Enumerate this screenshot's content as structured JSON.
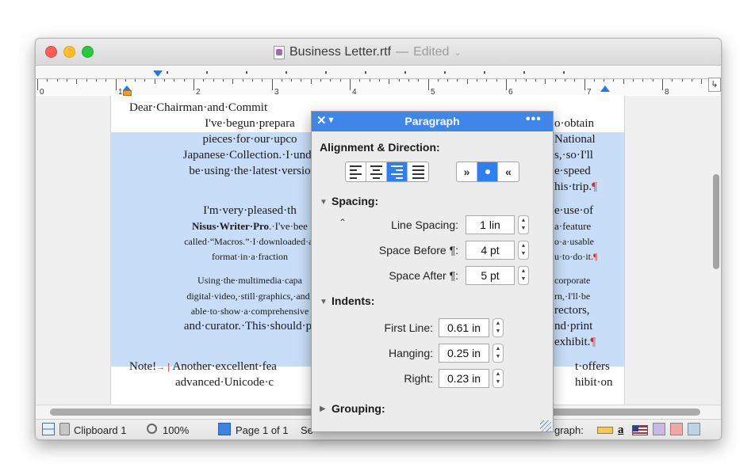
{
  "window": {
    "title": "Business Letter.rtf",
    "separator": "—",
    "status": "Edited",
    "status_chevron": "⌄"
  },
  "ruler": {
    "numbers": [
      "0",
      "1",
      "2",
      "3",
      "4",
      "5",
      "6",
      "7",
      "8"
    ],
    "corner_button": "↳"
  },
  "document": {
    "greeting": "Dear·Chairman·and·Commit",
    "para1": {
      "left": [
        "I've·begun·prepara",
        "pieces·for·our·upco",
        "Japanese·Collection.·I·unde",
        "be·using·the·latest·versio"
      ],
      "right": [
        "o·obtain",
        "National",
        "s,·so·I'll",
        "e·speed",
        "his·trip."
      ]
    },
    "para2": {
      "left_1": "I'm·very·pleased·th",
      "left_2_bold": "Nisus·Writer·Pro",
      "left_2_rest": ".·I've·bee",
      "left_3": "called·“Macros.”·I·downloaded·al",
      "left_4": "format·in·a·fraction",
      "right": [
        "e·use·of",
        "a·feature",
        "o·a·usable",
        "u·to·do·it."
      ]
    },
    "para3": {
      "left": [
        "Using·the·multimedia·capa",
        "digital·video,·still·graphics,·and·",
        "able·to·show·a·comprehensive",
        "and·curator.·This·should·pr"
      ],
      "right": [
        "corporate",
        "rn,·I'll·be",
        "rectors,",
        "nd·print",
        "exhibit."
      ]
    },
    "note": {
      "label": "Note!",
      "tab_arrow": "→❘",
      "line1_left": "Another·excellent·fea",
      "line1_right": "t·offers",
      "line2_left": "advanced·Unicode·c",
      "line2_right": "hibit·on"
    },
    "pilcrow": "¶"
  },
  "status_bar": {
    "clipboard": "Clipboard 1",
    "zoom": "100%",
    "page": "Page 1 of 1",
    "page_extra": "Se",
    "right_label": "graph:"
  },
  "panel": {
    "title": "Paragraph",
    "close": "✕",
    "collapse": "▼",
    "more": "•••",
    "alignment_heading": "Alignment & Direction:",
    "direction": {
      "ltr": "»",
      "rtl": "«"
    },
    "spacing_heading": "Spacing:",
    "line_spacing_label": "Line Spacing:",
    "line_spacing_value": "1 lin",
    "space_before_label": "Space Before ¶:",
    "space_before_value": "4 pt",
    "space_after_label": "Space After ¶:",
    "space_after_value": "5 pt",
    "indents_heading": "Indents:",
    "first_line_label": "First Line:",
    "first_line_value": "0.61 in",
    "hanging_label": "Hanging:",
    "hanging_value": "0.25 in",
    "right_label": "Right:",
    "right_value": "0.23 in",
    "grouping_heading": "Grouping:",
    "updown_glyph": "⌃⌄"
  },
  "colors": {
    "selection": "#c8ddf7",
    "accent": "#3f86ea",
    "pilcrow": "#d22c2c",
    "close_light": "#fe5f57",
    "minimize_light": "#febc2e",
    "zoom_light": "#28c840"
  },
  "icons": {
    "split_view": "split-view-icon",
    "clipboard": "clipboard-icon",
    "zoom": "magnifier-icon",
    "page": "page-icon",
    "ruler": "ruler-icon",
    "font": "font-a-icon",
    "flag": "us-flag-icon"
  }
}
